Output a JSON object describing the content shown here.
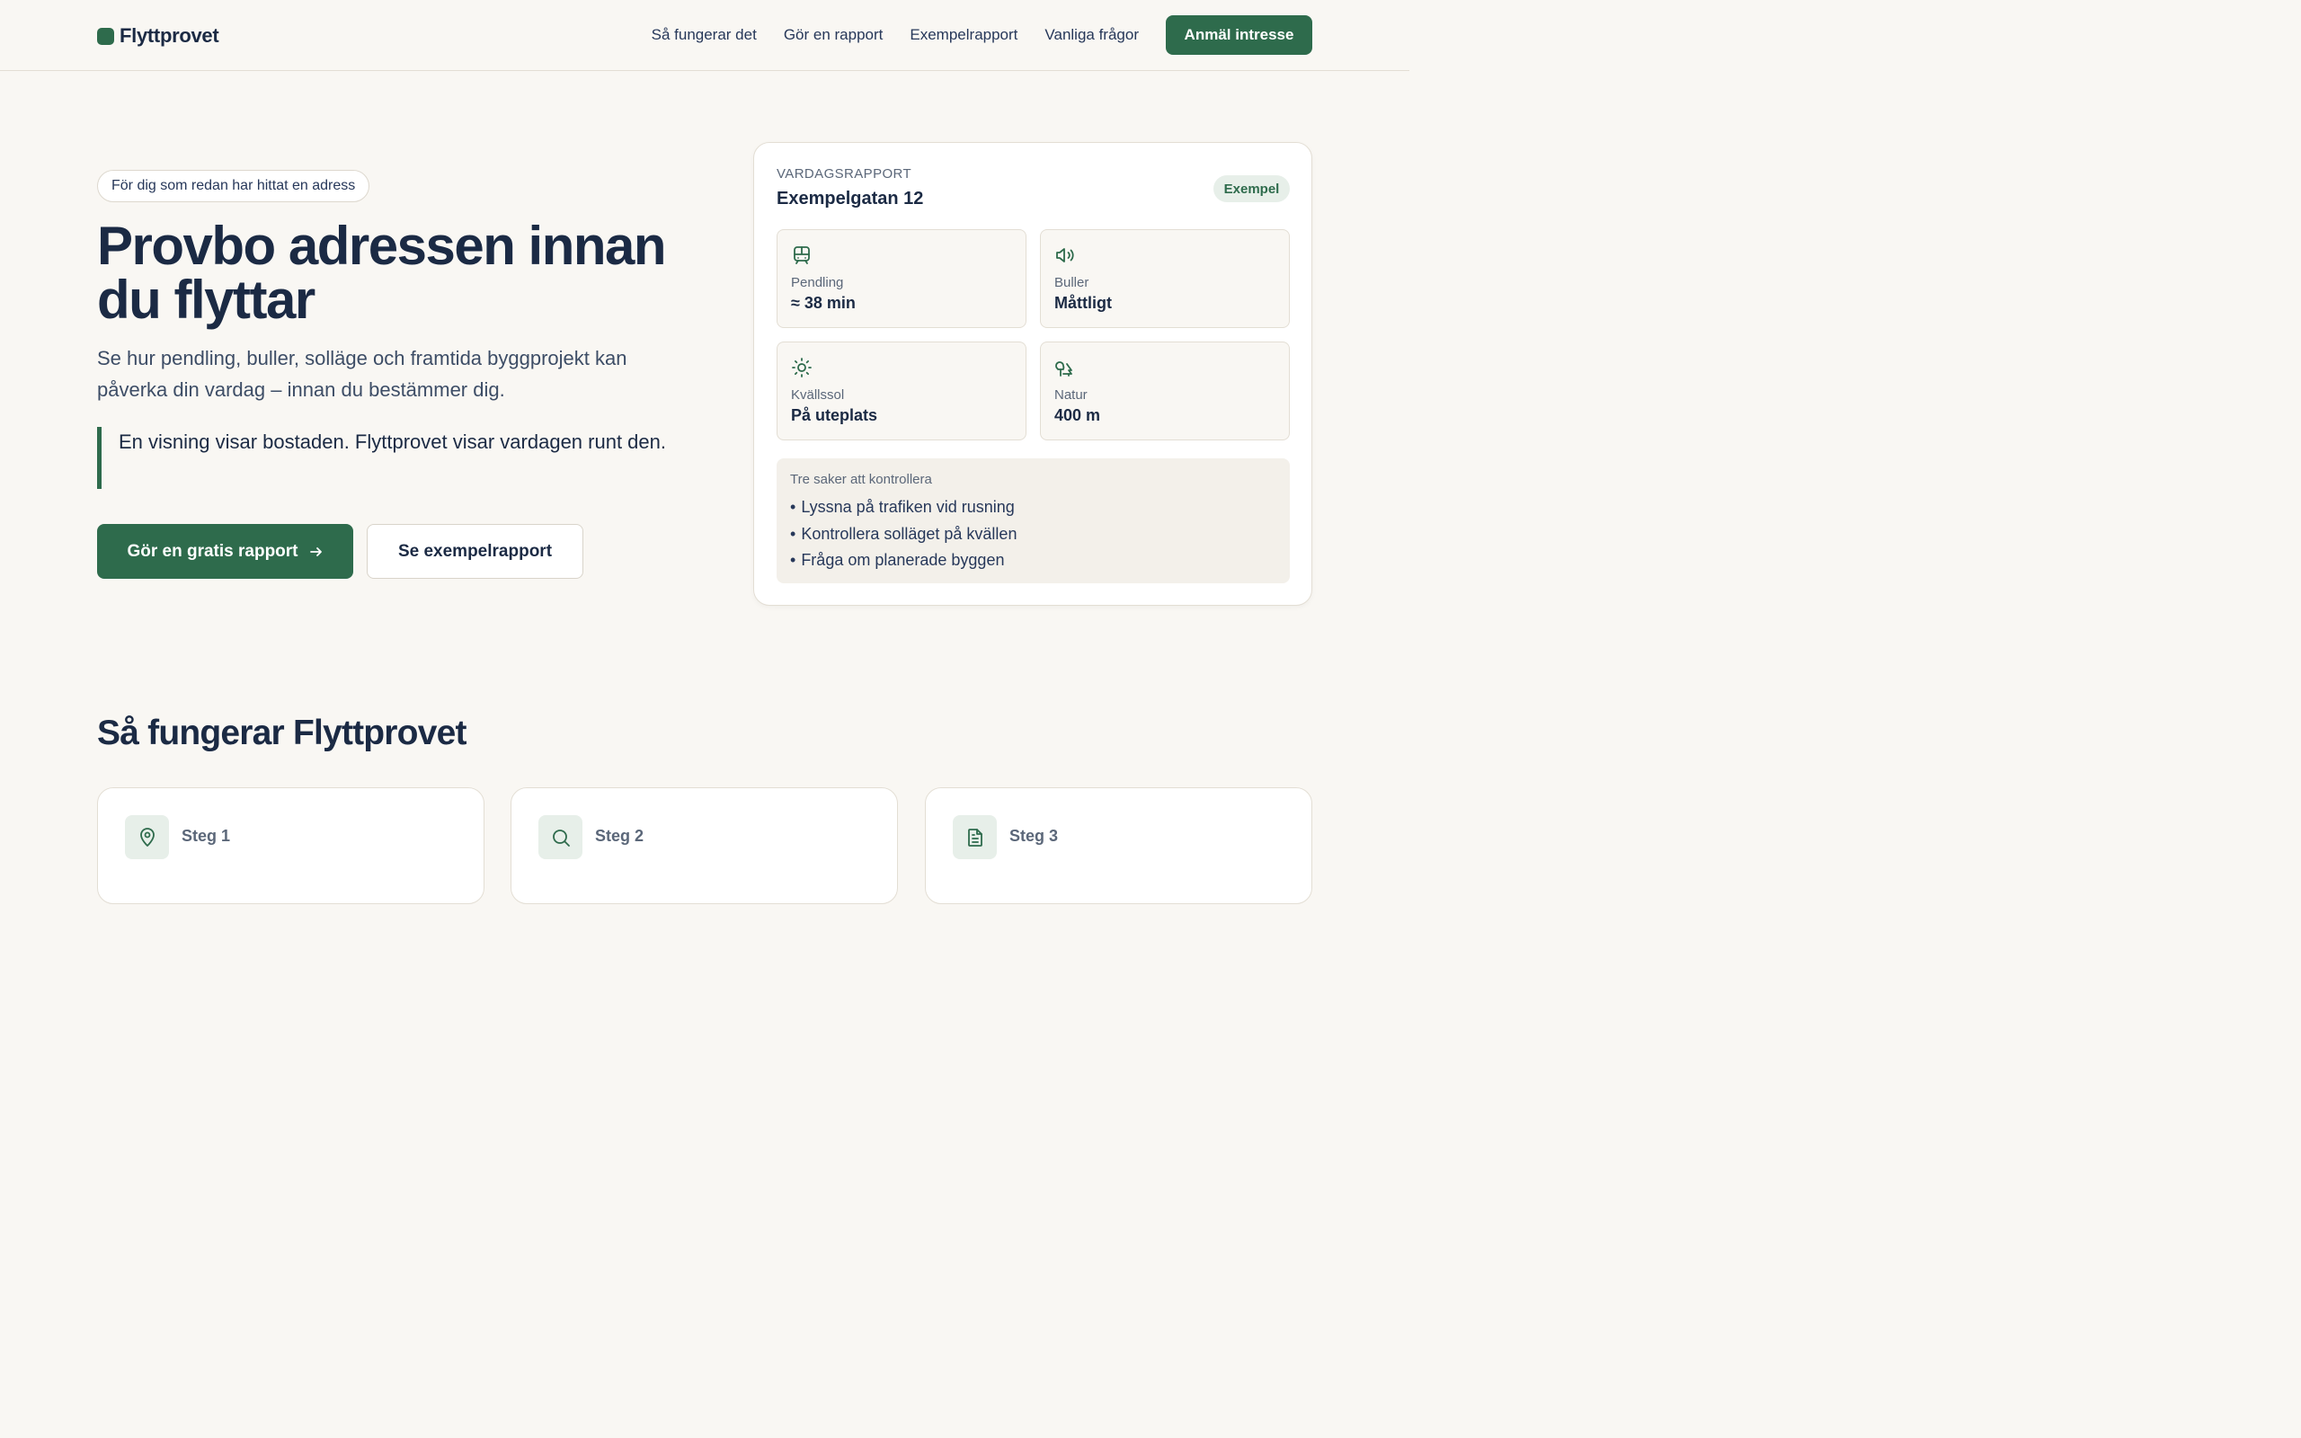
{
  "header": {
    "brand": "Flyttprovet",
    "nav": [
      {
        "label": "Så fungerar det"
      },
      {
        "label": "Gör en rapport"
      },
      {
        "label": "Exempelrapport"
      },
      {
        "label": "Vanliga frågor"
      }
    ],
    "cta_label": "Anmäl intresse"
  },
  "hero": {
    "pill": "För dig som redan har hittat en adress",
    "title": "Provbo adressen innan du flyttar",
    "subtitle": "Se hur pendling, buller, solläge och framtida byggprojekt kan påverka din vardag – innan du bestämmer dig.",
    "quote": "En visning visar bostaden. Flyttprovet visar vardagen runt den.",
    "primary_button": "Gör en gratis rapport",
    "secondary_button": "Se exempelrapport"
  },
  "report": {
    "eyebrow": "VARDAGSRAPPORT",
    "address": "Exempelgatan 12",
    "badge": "Exempel",
    "metrics": [
      {
        "icon": "train-icon",
        "label": "Pendling",
        "value": "≈ 38 min"
      },
      {
        "icon": "speaker-icon",
        "label": "Buller",
        "value": "Måttligt"
      },
      {
        "icon": "sun-icon",
        "label": "Kvällssol",
        "value": "På uteplats"
      },
      {
        "icon": "trees-icon",
        "label": "Natur",
        "value": "400 m"
      }
    ],
    "checklist_title": "Tre saker att kontrollera",
    "checklist": [
      "Lyssna på trafiken vid rusning",
      "Kontrollera solläget på kvällen",
      "Fråga om planerade byggen"
    ]
  },
  "how": {
    "title": "Så fungerar Flyttprovet",
    "steps": [
      {
        "icon": "map-pin-icon",
        "label": "Steg 1"
      },
      {
        "icon": "search-icon",
        "label": "Steg 2"
      },
      {
        "icon": "document-icon",
        "label": "Steg 3"
      }
    ]
  },
  "colors": {
    "accent": "#2e6b4c",
    "background": "#f9f7f3",
    "text": "#1b2a44"
  }
}
